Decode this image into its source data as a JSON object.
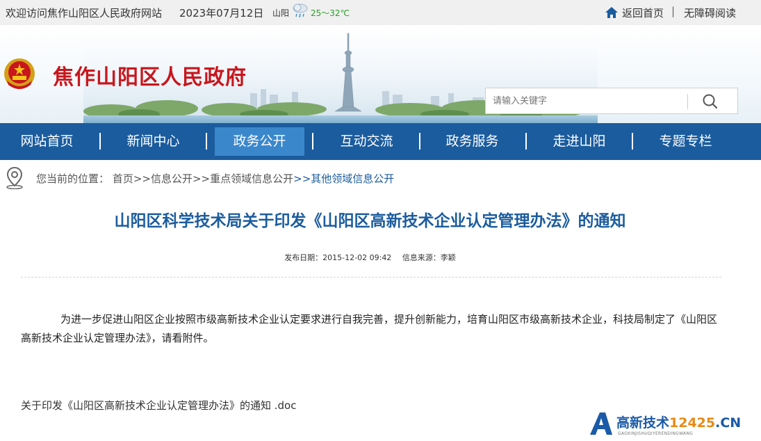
{
  "topbar": {
    "welcome": "欢迎访问焦作山阳区人民政府网站",
    "date": "2023年07月12日",
    "city": "山阳",
    "weather_icon": "cloud-rain-icon",
    "temperature": "25～32℃",
    "home_link": "返回首页",
    "separator": "|",
    "accessibility": "无障碍阅读"
  },
  "header": {
    "title": "焦作山阳区人民政府",
    "search": {
      "placeholder": "请输入关键字"
    }
  },
  "nav": {
    "items": [
      {
        "label": "网站首页",
        "active": false
      },
      {
        "label": "新闻中心",
        "active": false
      },
      {
        "label": "政务公开",
        "active": true
      },
      {
        "label": "互动交流",
        "active": false
      },
      {
        "label": "政务服务",
        "active": false
      },
      {
        "label": "走进山阳",
        "active": false
      },
      {
        "label": "专题专栏",
        "active": false
      }
    ],
    "separator": "|"
  },
  "breadcrumb": {
    "prefix": "您当前的位置：",
    "items": [
      "首页",
      "信息公开",
      "重点领域信息公开",
      "其他领域信息公开"
    ],
    "separator": ">>"
  },
  "article": {
    "title": "山阳区科学技术局关于印发《山阳区高新技术企业认定管理办法》的通知",
    "publish_date": "发布日期：2015-12-02 09:42",
    "source": "信息来源：李颖",
    "body": "为进一步促进山阳区企业按照市级高新技术企业认定要求进行自我完善，提升创新能力，培育山阳区市级高新技术企业，科技局制定了《山阳区高新技术企业认定管理办法》，请看附件。",
    "attachment": "关于印发《山阳区高新技术企业认定管理办法》的通知 .doc"
  },
  "watermark": {
    "text_main": "高新技术",
    "text_num": "12425",
    "text_tail": ".CN",
    "sub": "GAOXINJISHUQIYERENDINGWANG"
  },
  "colors": {
    "nav_bg": "#1b5c9e",
    "nav_active": "#3b87cc",
    "title_red": "#c8161d",
    "article_blue": "#1b5c9e"
  }
}
